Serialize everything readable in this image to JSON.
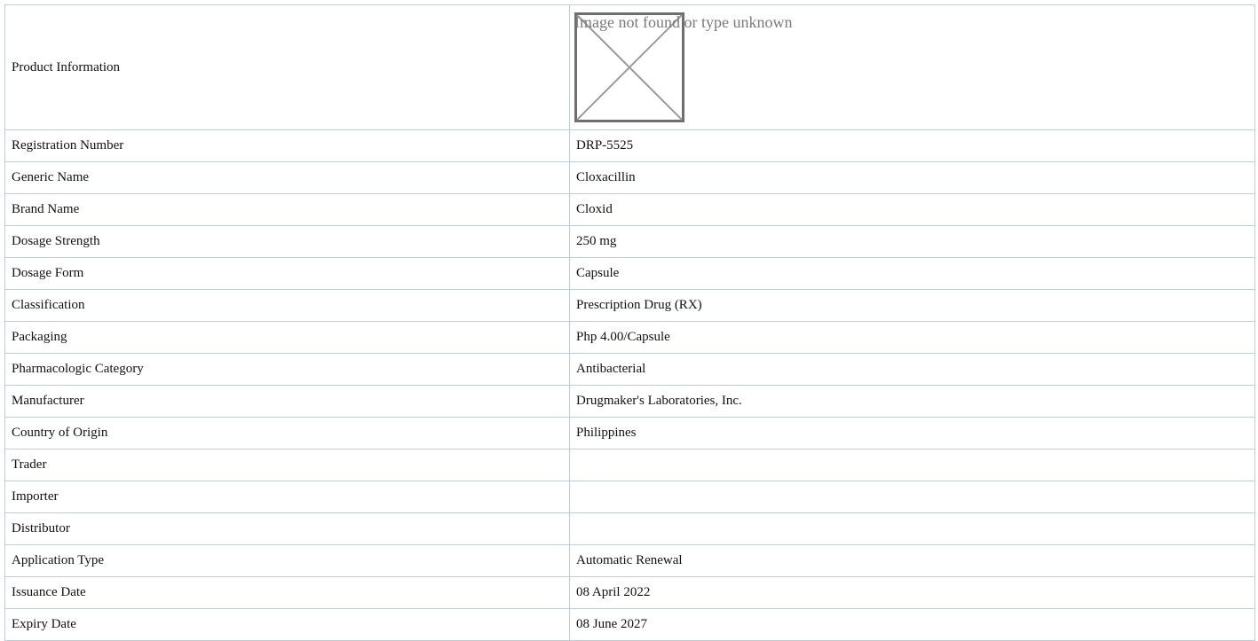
{
  "header": {
    "label": "Product Information",
    "image_alt": "Image not found or type unknown",
    "image_icon": "broken-image-icon"
  },
  "rows": [
    {
      "label": "Registration Number",
      "value": "DRP-5525"
    },
    {
      "label": "Generic Name",
      "value": "Cloxacillin"
    },
    {
      "label": "Brand Name",
      "value": "Cloxid"
    },
    {
      "label": "Dosage Strength",
      "value": "250 mg"
    },
    {
      "label": "Dosage Form",
      "value": "Capsule"
    },
    {
      "label": "Classification",
      "value": "Prescription Drug (RX)"
    },
    {
      "label": "Packaging",
      "value": "Php 4.00/Capsule"
    },
    {
      "label": "Pharmacologic Category",
      "value": "Antibacterial"
    },
    {
      "label": "Manufacturer",
      "value": "Drugmaker's Laboratories, Inc."
    },
    {
      "label": "Country of Origin",
      "value": "Philippines"
    },
    {
      "label": "Trader",
      "value": ""
    },
    {
      "label": "Importer",
      "value": ""
    },
    {
      "label": "Distributor",
      "value": ""
    },
    {
      "label": "Application Type",
      "value": "Automatic Renewal"
    },
    {
      "label": "Issuance Date",
      "value": "08 April 2022"
    },
    {
      "label": "Expiry Date",
      "value": "08 June 2027"
    }
  ]
}
